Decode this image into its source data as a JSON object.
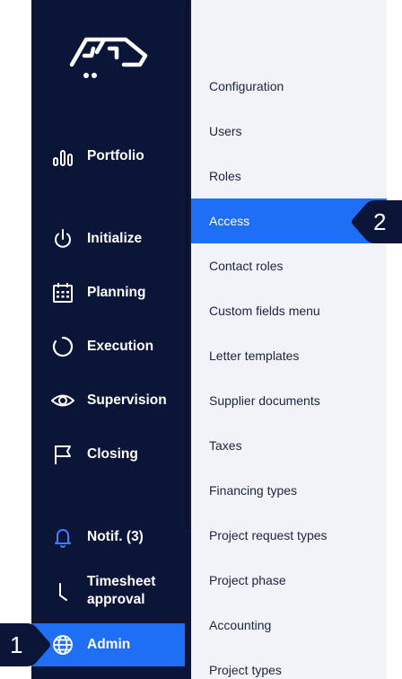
{
  "sidebar": {
    "items": [
      {
        "label": "Portfolio",
        "icon": "bar-chart-icon"
      },
      {
        "label": "Initialize",
        "icon": "power-icon"
      },
      {
        "label": "Planning",
        "icon": "calendar-icon"
      },
      {
        "label": "Execution",
        "icon": "progress-circle-icon"
      },
      {
        "label": "Supervision",
        "icon": "eye-icon"
      },
      {
        "label": "Closing",
        "icon": "flag-icon"
      },
      {
        "label": "Notif. (3)",
        "icon": "bell-icon"
      },
      {
        "label_line1": "Timesheet",
        "label_line2": "approval",
        "icon": "clock-hand-icon"
      },
      {
        "label": "Admin",
        "icon": "globe-icon",
        "active": true
      }
    ]
  },
  "submenu": {
    "items": [
      {
        "label": "Configuration"
      },
      {
        "label": "Users"
      },
      {
        "label": "Roles"
      },
      {
        "label": "Access",
        "active": true
      },
      {
        "label": "Contact roles"
      },
      {
        "label": "Custom fields menu"
      },
      {
        "label": "Letter templates"
      },
      {
        "label": "Supplier documents"
      },
      {
        "label": "Taxes"
      },
      {
        "label": "Financing types"
      },
      {
        "label": "Project request types"
      },
      {
        "label": "Project phase"
      },
      {
        "label": "Accounting"
      },
      {
        "label": "Project types"
      }
    ]
  },
  "callouts": [
    {
      "number": "1"
    },
    {
      "number": "2"
    }
  ],
  "colors": {
    "sidebar_bg": "#0b1538",
    "submenu_bg": "#f1f3f8",
    "accent": "#1e6ff5",
    "bell_icon": "#3d7dff"
  }
}
